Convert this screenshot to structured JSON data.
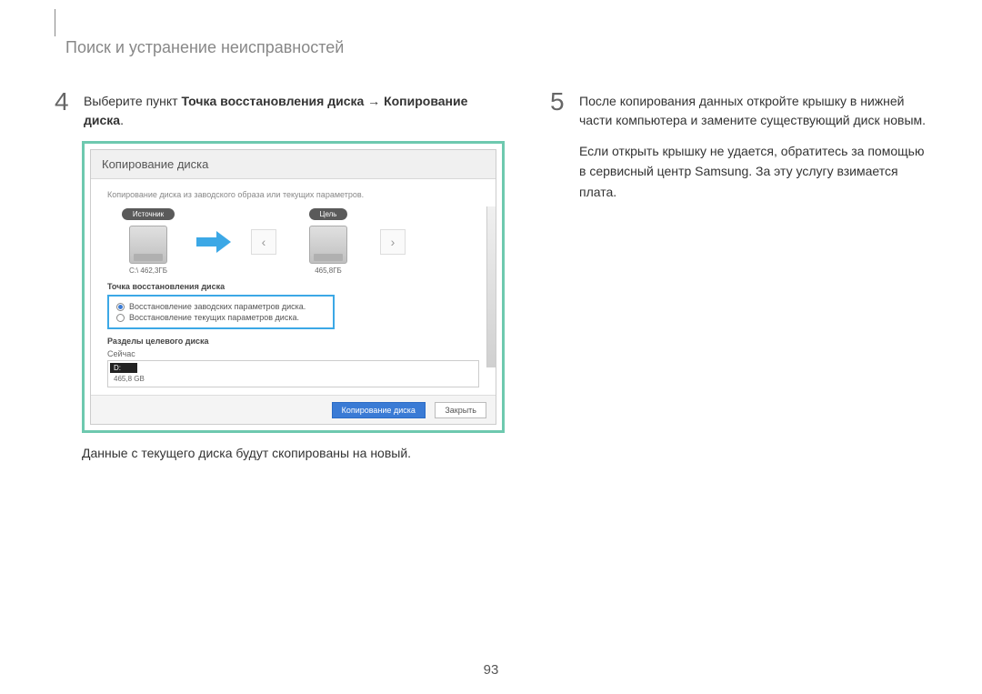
{
  "header": {
    "title": "Поиск и устранение неисправностей"
  },
  "left": {
    "step_num": "4",
    "step_text_prefix": "Выберите пункт ",
    "step_text_bold1": "Точка восстановления диска",
    "step_text_arrow": " → ",
    "step_text_bold2": "Копирование диска",
    "step_text_suffix": ".",
    "screenshot": {
      "title": "Копирование диска",
      "description": "Копирование диска из заводского образа или текущих параметров.",
      "source_label": "Источник",
      "source_cap": "С:\\ 462,3ГБ",
      "target_label": "Цель",
      "target_cap": "465,8ГБ",
      "recovery_section": "Точка восстановления диска",
      "radio1": "Восстановление заводских параметров диска.",
      "radio2": "Восстановление текущих параметров диска.",
      "partitions_section": "Разделы целевого диска",
      "now_label": "Сейчас",
      "bar_letter": "D:",
      "bar_size": "465,8 GB",
      "btn_primary": "Копирование диска",
      "btn_close": "Закрыть"
    },
    "caption": "Данные с текущего диска будут скопированы на новый."
  },
  "right": {
    "step_num": "5",
    "step_text": "После копирования данных откройте крышку в нижней части компьютера и замените существующий диск новым.",
    "continue_text": "Если открыть крышку не удается, обратитесь за помощью в сервисный центр Samsung. За эту услугу взимается плата."
  },
  "page_number": "93"
}
